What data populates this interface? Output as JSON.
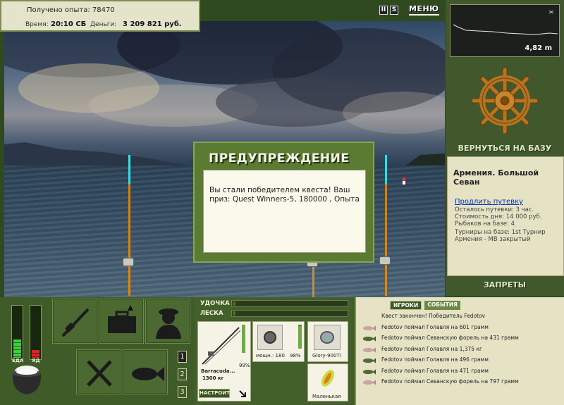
{
  "top_info": {
    "experience_label": "Получено опыта: 78470",
    "time_label": "Время:",
    "time_value": "20:10 СБ",
    "money_label": "Деньги:",
    "money_value": "3 209 821 руб."
  },
  "top_controls": {
    "pause_symbol": "II",
    "sound_symbol": "S",
    "menu_label": "МЕНЮ"
  },
  "right_panel": {
    "depth_value": "4,82 m",
    "back_to_base": "ВЕРНУТЬСЯ НА БАЗУ",
    "location_title": "Армения. Большой Севан",
    "extend_link": "Продлить путевку",
    "info_lines": [
      "Осталось путевки: 3 час.",
      "Стоимость дня: 14 000 руб.",
      "Рыбаков на базе: 4",
      "",
      "Турниры на базе: 1st Турнир",
      "Армения - МВ закрытый"
    ],
    "bans_label": "ЗАПРЕТЫ"
  },
  "dialog": {
    "title": "ПРЕДУПРЕЖДЕНИЕ",
    "message": "Вы стали победителем квеста! Ваш приз: Quest Winners-5, 180000 , Опыта"
  },
  "status": {
    "food_label": "ЕДА",
    "poison_label": "ЯД",
    "food_level": 0.35,
    "poison_level": 0.15
  },
  "pages": [
    "1",
    "2",
    "3"
  ],
  "tackle": {
    "rod_label": "УДОЧКА",
    "line_label": "ЛЕСКА",
    "rod_name": "Barracuda...",
    "rod_weight": "1300 кг",
    "rod_condition": "99%",
    "reel_info": "мощн.: 180",
    "reel_condition": "98%",
    "line_name": "Glory-900Ti",
    "lure_name": "Маленькая",
    "setup_button": "НАСТРОИТЬ"
  },
  "events": {
    "tab_players": "ИГРОКИ",
    "tab_events": "СОБЫТИЯ",
    "items": [
      {
        "fish": "none",
        "text": "Квест закончен! Победитель Fedotov"
      },
      {
        "fish": "chub",
        "text": "Fedotov поймал Голавля на 601 грамм"
      },
      {
        "fish": "trout",
        "text": "Fedotov поймал Севанскую форель на 431 грамм"
      },
      {
        "fish": "chub",
        "text": "Fedotov поймал Голавля на 1,375 кг"
      },
      {
        "fish": "trout",
        "text": "Fedotov поймал Голавля на 496 грамм"
      },
      {
        "fish": "trout",
        "text": "Fedotov поймал Голавля на 471 грамм"
      },
      {
        "fish": "chub",
        "text": "Fedotov поймал Севанскую форель на 797 грамм"
      }
    ]
  },
  "colors": {
    "panel_green": "#40582b",
    "panel_light": "#e6e3c4",
    "food_green": "#3bd13b",
    "poison_red": "#e22222",
    "rod_tip": "#3ed8e0"
  }
}
